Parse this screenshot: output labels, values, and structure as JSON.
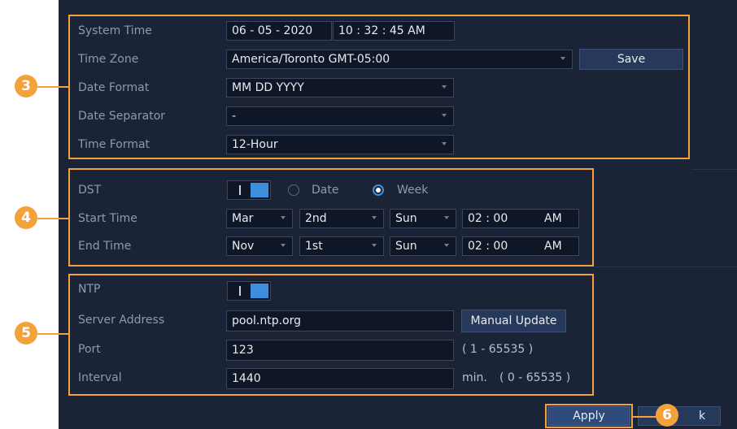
{
  "system_time": {
    "label": "System Time",
    "date": "06 - 05 - 2020",
    "time": "10 : 32 : 45 AM"
  },
  "time_zone": {
    "label": "Time Zone",
    "value": "America/Toronto GMT-05:00",
    "save_label": "Save"
  },
  "date_format": {
    "label": "Date Format",
    "value": "MM DD YYYY"
  },
  "date_separator": {
    "label": "Date Separator",
    "value": "-"
  },
  "time_format": {
    "label": "Time Format",
    "value": "12-Hour"
  },
  "dst": {
    "label": "DST",
    "enabled": true,
    "mode_options": [
      "Date",
      "Week"
    ],
    "selected_mode": "Week",
    "start": {
      "label": "Start Time",
      "month": "Mar",
      "week": "2nd",
      "day": "Sun",
      "time": "02 : 00",
      "ampm": "AM"
    },
    "end": {
      "label": "End Time",
      "month": "Nov",
      "week": "1st",
      "day": "Sun",
      "time": "02 : 00",
      "ampm": "AM"
    }
  },
  "ntp": {
    "label": "NTP",
    "enabled": true,
    "server_label": "Server Address",
    "server_value": "pool.ntp.org",
    "manual_update_label": "Manual Update",
    "port_label": "Port",
    "port_value": "123",
    "port_range": "( 1 - 65535 )",
    "interval_label": "Interval",
    "interval_value": "1440",
    "interval_unit": "min.",
    "interval_range": "( 0 - 65535 )"
  },
  "footer": {
    "apply_label": "Apply",
    "back_label": "k"
  },
  "callouts": {
    "three": "3",
    "four": "4",
    "five": "5",
    "six": "6"
  },
  "colors": {
    "panel": "#1a2436",
    "highlight": "#f2a13b",
    "toggle_on": "#3e8ee0"
  }
}
